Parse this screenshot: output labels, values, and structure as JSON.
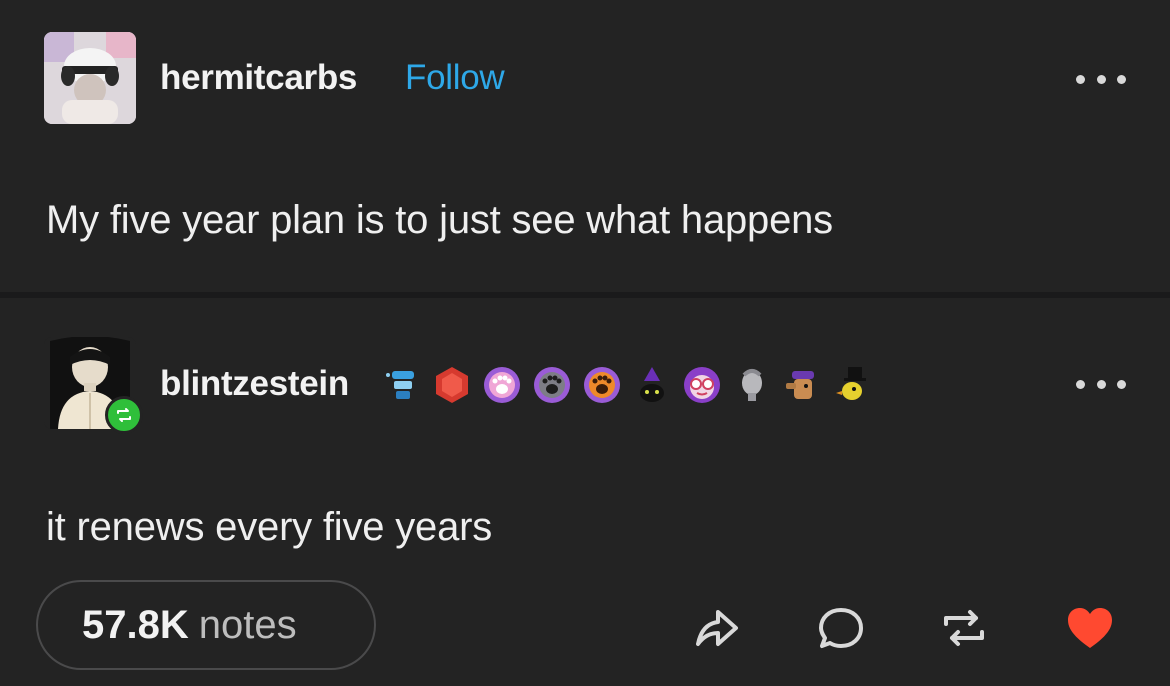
{
  "posts": [
    {
      "username": "hermitcarbs",
      "follow_label": "Follow",
      "text": "My five year plan is to just see what happens"
    },
    {
      "username": "blintzestein",
      "text": "it renews every five years",
      "badge_icons": [
        "snowglobe-badge-icon",
        "d20-badge-icon",
        "pink-paw-badge-icon",
        "grey-paw-badge-icon",
        "orange-paw-badge-icon",
        "witch-cat-badge-icon",
        "sunglasses-face-badge-icon",
        "statue-head-badge-icon",
        "cowboy-dog-badge-icon",
        "top-hat-duck-badge-icon"
      ]
    }
  ],
  "footer": {
    "notes_count": "57.8K",
    "notes_label": "notes"
  },
  "colors": {
    "background": "#232323",
    "follow": "#2ea8e8",
    "like": "#ff4930",
    "reblog_indicator": "#2fbf3a"
  }
}
